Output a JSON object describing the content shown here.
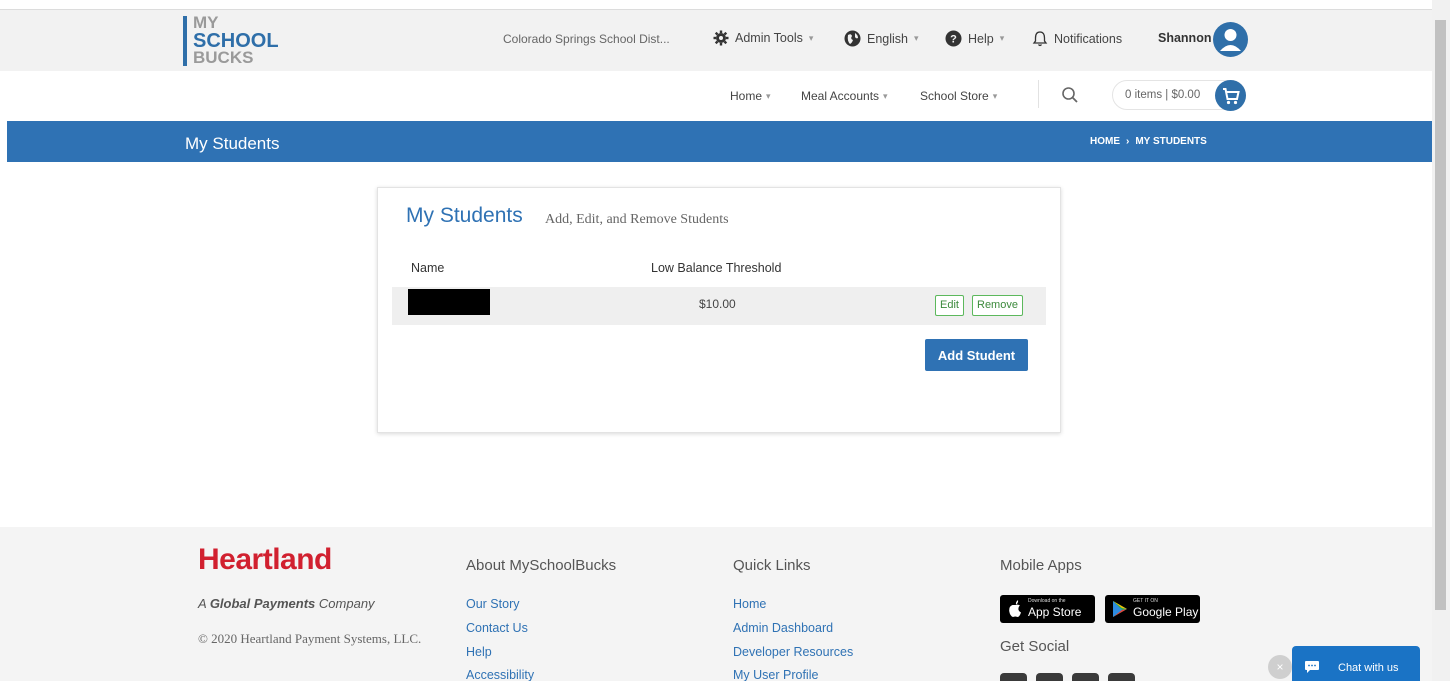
{
  "header": {
    "logo": {
      "line1": "MY",
      "line2": "SCHOOL",
      "line3": "BUCKS"
    },
    "district": "Colorado Springs School Dist...",
    "admin_tools": "Admin Tools",
    "language": "English",
    "help": "Help",
    "notifications": "Notifications",
    "user_name": "Shannon"
  },
  "nav": {
    "home": "Home",
    "meal_accounts": "Meal Accounts",
    "school_store": "School Store",
    "cart_text": "0 items | $0.00"
  },
  "banner": {
    "title": "My Students",
    "breadcrumb_home": "HOME",
    "breadcrumb_current": "MY STUDENTS"
  },
  "card": {
    "title": "My Students",
    "subtitle": "Add, Edit, and Remove Students",
    "columns": {
      "name": "Name",
      "threshold": "Low Balance Threshold"
    },
    "rows": [
      {
        "name": "",
        "threshold": "$10.00",
        "edit": "Edit",
        "remove": "Remove"
      }
    ],
    "add_button": "Add Student"
  },
  "footer": {
    "brand": "Heartland",
    "tagline_prefix": "A ",
    "tagline_bold": "Global Payments",
    "tagline_suffix": " Company",
    "copyright": "© 2020 Heartland Payment Systems, LLC.",
    "about": {
      "heading": "About MySchoolBucks",
      "links": [
        "Our Story",
        "Contact Us",
        "Help",
        "Accessibility"
      ]
    },
    "quick": {
      "heading": "Quick Links",
      "links": [
        "Home",
        "Admin Dashboard",
        "Developer Resources",
        "My User Profile"
      ]
    },
    "mobile": {
      "heading": "Mobile Apps",
      "app_store_small": "Download on the",
      "app_store": "App Store",
      "google_small": "GET IT ON",
      "google": "Google Play",
      "social_heading": "Get Social"
    }
  },
  "chat": {
    "label": "Chat with us",
    "close": "×"
  },
  "colors": {
    "primary": "#2f72b4",
    "brand_red": "#d1202f",
    "success_border": "#5cb85c"
  }
}
